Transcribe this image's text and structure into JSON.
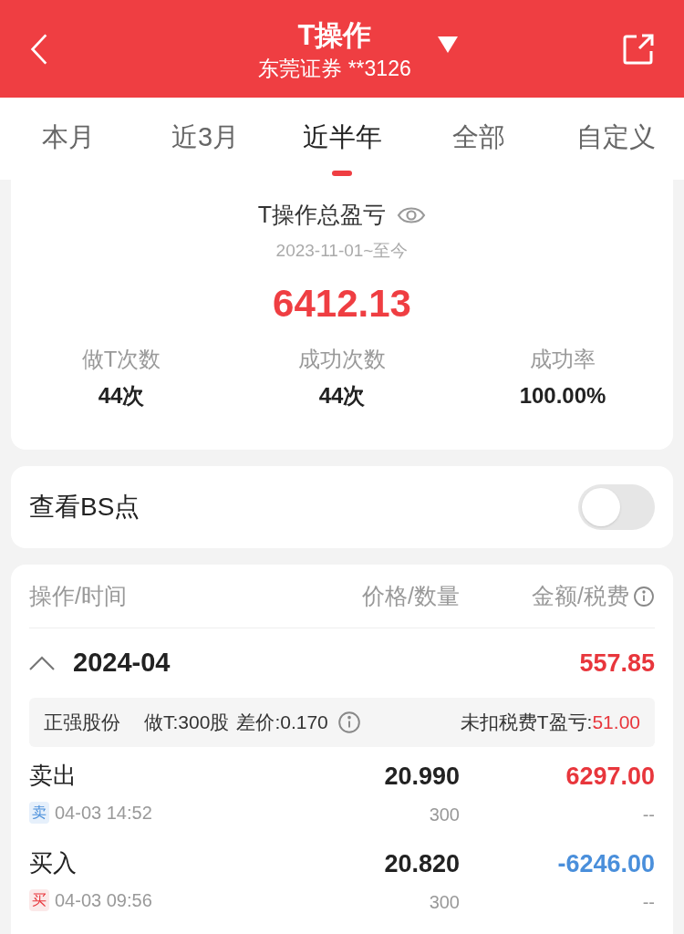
{
  "header": {
    "title": "T操作",
    "subtitle": "东莞证券 **3126"
  },
  "tabs": [
    {
      "label": "本月",
      "selected": false
    },
    {
      "label": "近3月",
      "selected": false
    },
    {
      "label": "近半年",
      "selected": true
    },
    {
      "label": "全部",
      "selected": false
    },
    {
      "label": "自定义",
      "selected": false
    }
  ],
  "summary": {
    "title": "T操作总盈亏",
    "period": "2023-11-01~至今",
    "total": "6412.13",
    "stats": [
      {
        "label": "做T次数",
        "value": "44次"
      },
      {
        "label": "成功次数",
        "value": "44次"
      },
      {
        "label": "成功率",
        "value": "100.00%"
      }
    ]
  },
  "bs_toggle": {
    "label": "查看BS点",
    "on": false
  },
  "table": {
    "columns": [
      "操作/时间",
      "价格/数量",
      "金额/税费"
    ],
    "groups": [
      {
        "month": "2024-04",
        "total": "557.85",
        "expanded": true,
        "stock": {
          "name": "正强股份",
          "shares": "做T:300股",
          "spread": "差价:0.170",
          "profit_label": "未扣税费T盈亏:",
          "profit": "51.00"
        },
        "trades": [
          {
            "kind": "sell",
            "action": "卖出",
            "badge": "卖",
            "time": "04-03 14:52",
            "price": "20.990",
            "quantity": "300",
            "amount": "6297.00",
            "fee": "--"
          },
          {
            "kind": "buy",
            "action": "买入",
            "badge": "买",
            "time": "04-03 09:56",
            "price": "20.820",
            "quantity": "300",
            "amount": "-6246.00",
            "fee": "--"
          }
        ]
      }
    ]
  }
}
